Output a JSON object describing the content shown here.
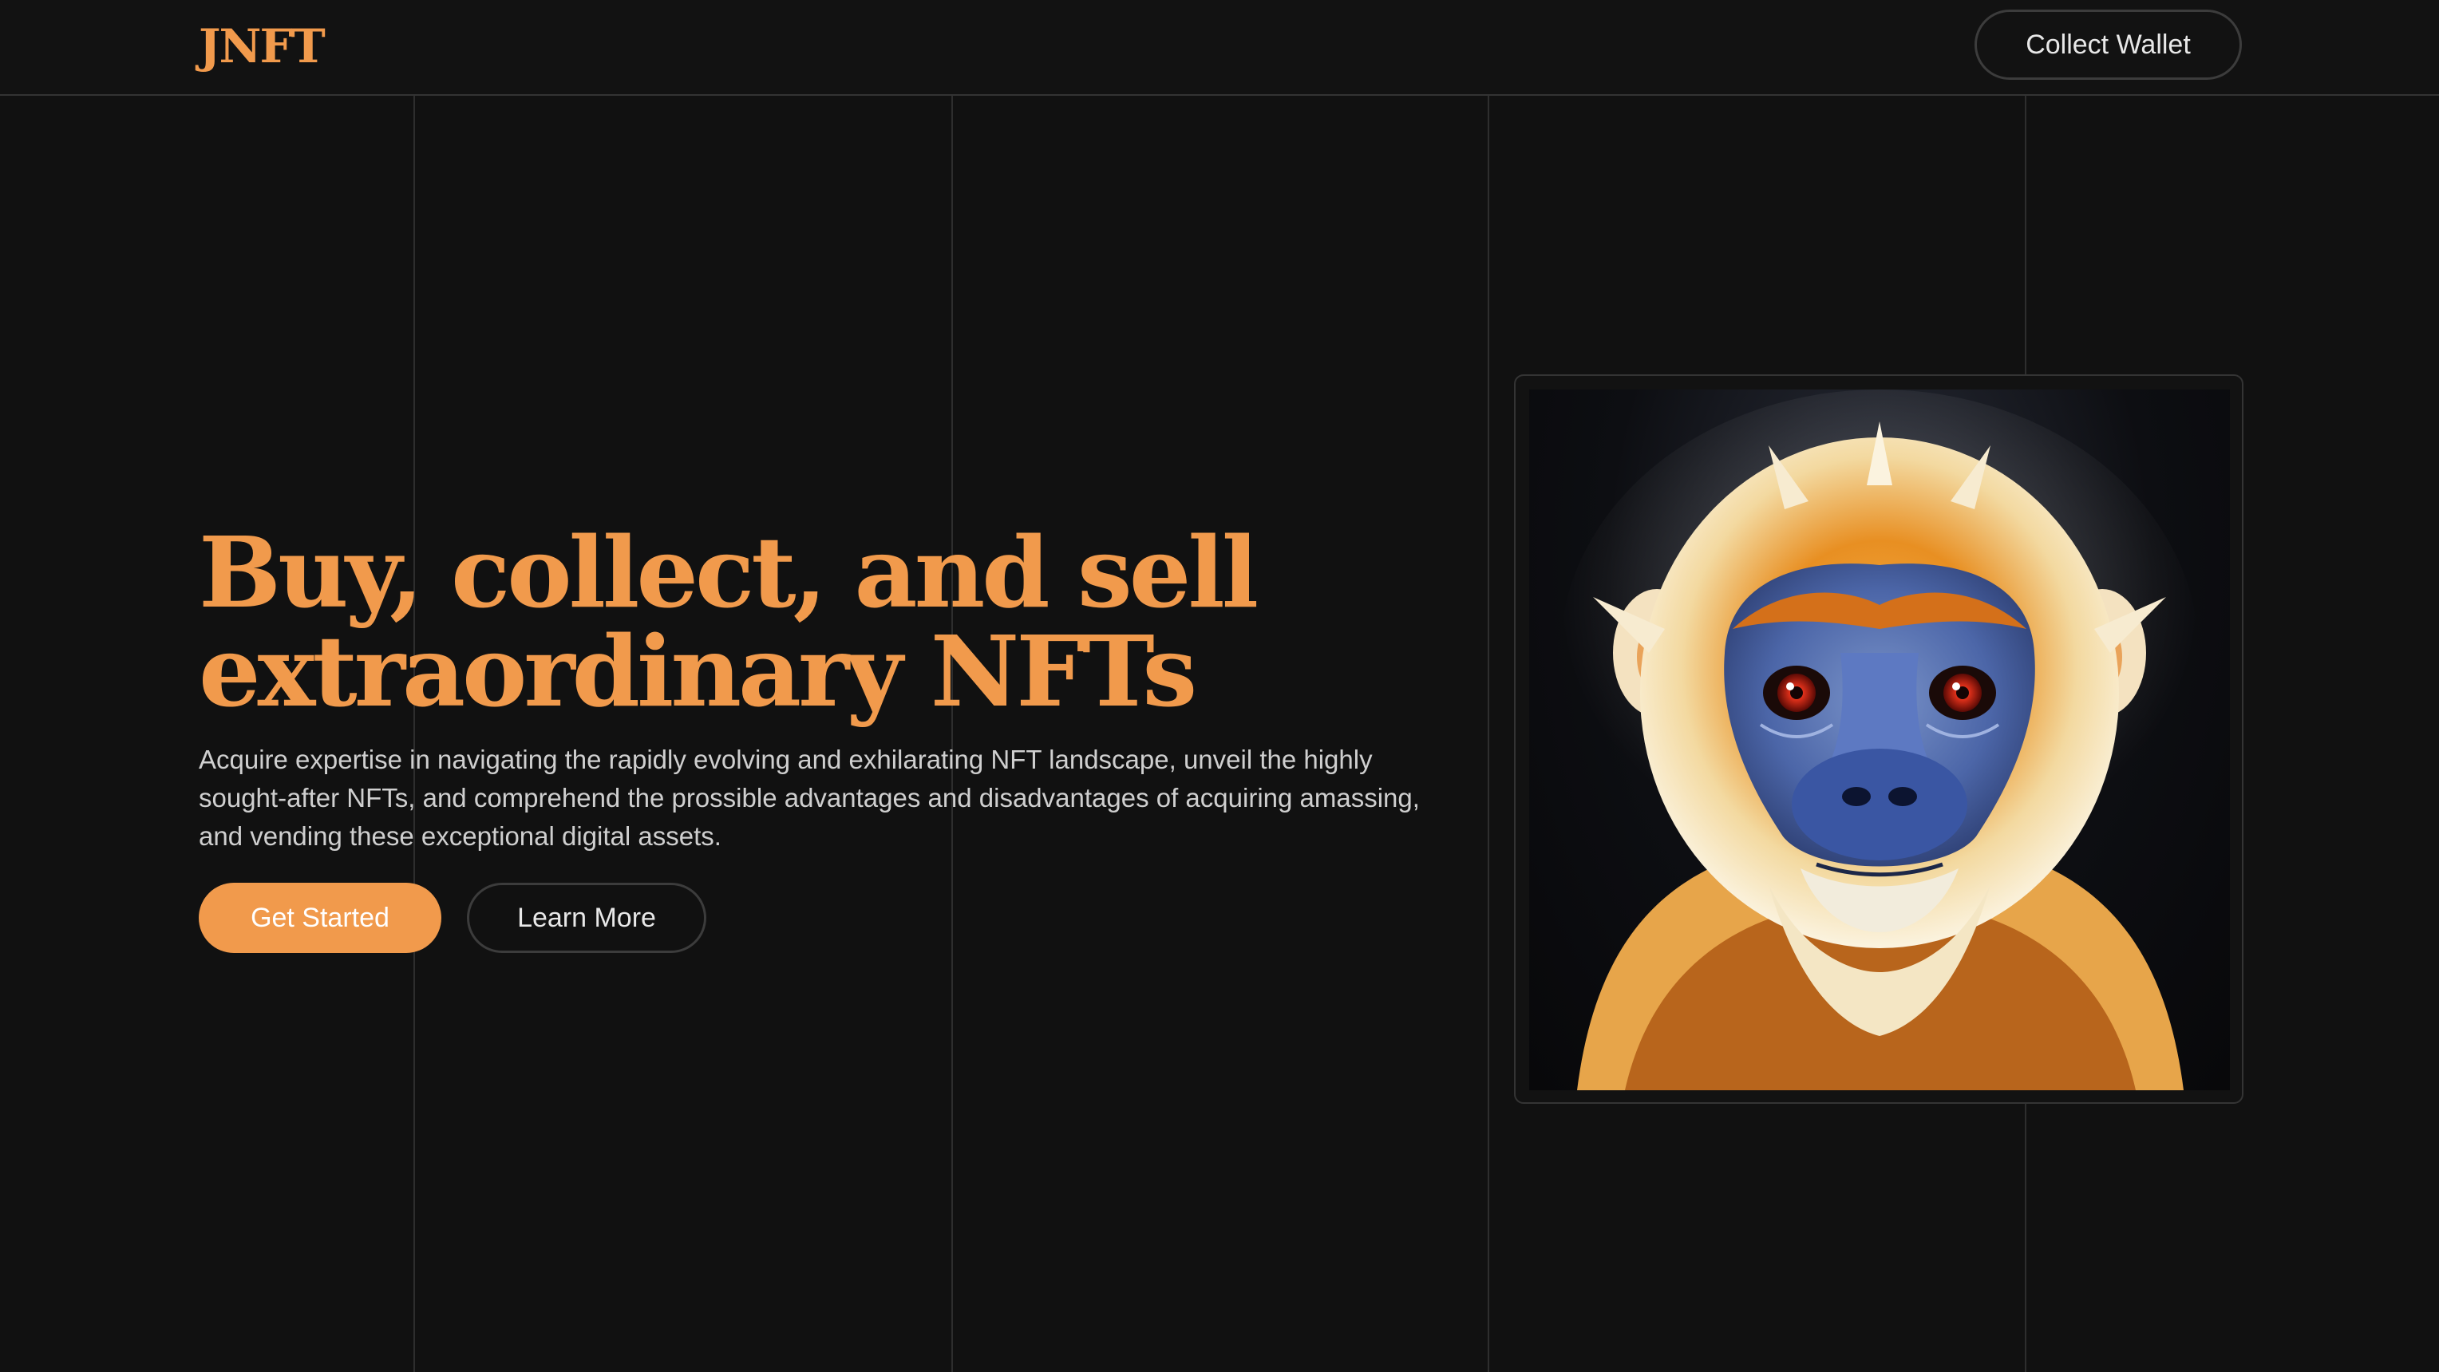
{
  "header": {
    "logo": "JNFT",
    "wallet_button": "Collect Wallet"
  },
  "hero": {
    "headline_line1": "Buy, collect, and sell",
    "headline_line2": "extraordinary NFTs",
    "description": "Acquire expertise in navigating the rapidly evolving and exhilarating NFT landscape, unveil the highly sought-after NFTs, and comprehend the prossible advantages and disadvantages of acquiring amassing, and vending these exceptional digital assets.",
    "primary_button": "Get Started",
    "secondary_button": "Learn More"
  },
  "artwork": {
    "subject": "monkey-portrait-image"
  },
  "colors": {
    "accent": "#f19a4c",
    "background": "#111111",
    "text_muted": "#cfcfcf"
  }
}
